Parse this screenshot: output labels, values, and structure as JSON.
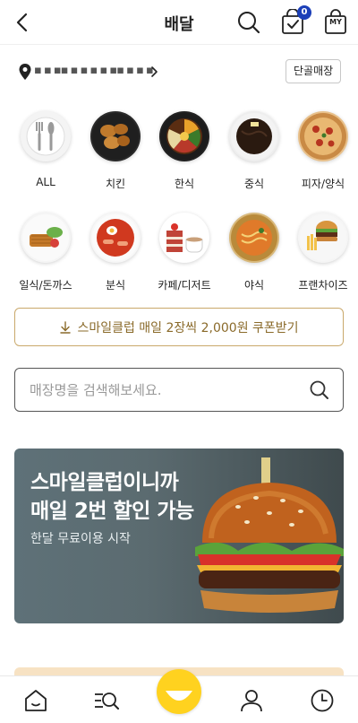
{
  "header": {
    "title": "배달",
    "cart_count": "0",
    "my_label": "MY"
  },
  "address": {
    "text": "▪ ▪ ▪▪ ▪ ▪ ▪ ▪ ▪▪ ▪ ▪ ▪",
    "regular_store_label": "단골매장"
  },
  "categories": [
    {
      "label": "ALL",
      "icon": "cutlery-icon"
    },
    {
      "label": "치킨",
      "icon": "chicken-icon"
    },
    {
      "label": "한식",
      "icon": "bibimbap-icon"
    },
    {
      "label": "중식",
      "icon": "jajangmyeon-icon"
    },
    {
      "label": "피자/양식",
      "icon": "pizza-icon"
    },
    {
      "label": "일식/돈까스",
      "icon": "tonkatsu-icon"
    },
    {
      "label": "분식",
      "icon": "tteokbokki-icon"
    },
    {
      "label": "카페/디저트",
      "icon": "cake-coffee-icon"
    },
    {
      "label": "야식",
      "icon": "ramen-icon"
    },
    {
      "label": "프랜차이즈",
      "icon": "burger-fries-icon"
    }
  ],
  "coupon": {
    "label": "스마일클럽 매일 2장씩 2,000원 쿠폰받기"
  },
  "search": {
    "placeholder": "매장명을 검색해보세요."
  },
  "banner": {
    "title": "스마일클럽이니까\n매일 2번 할인 가능",
    "subtitle": "한달 무료이용 시작"
  },
  "colors": {
    "accent_gold": "#c9a86a",
    "badge_blue": "#1b3fb8",
    "smile_yellow": "#ffd21f"
  },
  "bottom_nav": {
    "icons": [
      "home-icon",
      "menu-search-icon",
      "smile-icon",
      "user-icon",
      "clock-icon"
    ]
  }
}
